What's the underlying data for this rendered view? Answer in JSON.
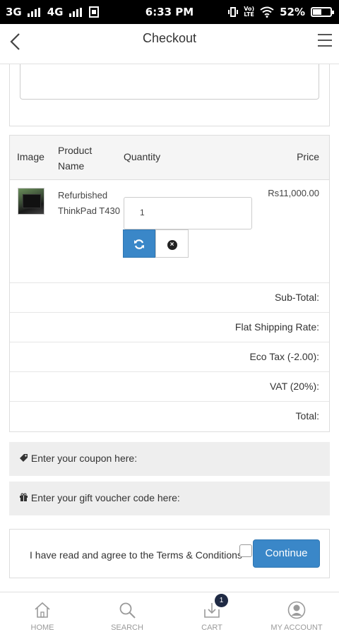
{
  "status_bar": {
    "network1": "3G",
    "network2": "4G",
    "time": "6:33 PM",
    "lte": "LTE",
    "volte": "Vo)",
    "battery_percent": "52%",
    "battery_level": 0.52
  },
  "header": {
    "title": "Checkout",
    "back_icon": "chevron-left-icon",
    "menu_icon": "hamburger-menu-icon"
  },
  "cart": {
    "columns": {
      "image": "Image",
      "product_name": "Product Name",
      "quantity": "Quantity",
      "price": "Price"
    },
    "items": [
      {
        "name": "Refurbished ThinkPad T430",
        "quantity": "1",
        "unit_price": "Rs11,000.00"
      }
    ],
    "totals": [
      {
        "label": "Sub-Total:"
      },
      {
        "label": "Flat Shipping Rate:"
      },
      {
        "label": "Eco Tax (-2.00):"
      },
      {
        "label": "VAT (20%):"
      },
      {
        "label": "Total:"
      }
    ]
  },
  "coupon": {
    "label": "Enter your coupon here:",
    "icon": "tag-icon"
  },
  "voucher": {
    "label": "Enter your gift voucher code here:",
    "icon": "gift-icon"
  },
  "terms": {
    "text": "I have read and agree to the Terms & Conditions",
    "continue_label": "Continue"
  },
  "bottom_nav": [
    {
      "label": "HOME",
      "icon": "home-icon"
    },
    {
      "label": "SEARCH",
      "icon": "search-icon"
    },
    {
      "label": "CART",
      "icon": "cart-download-icon",
      "badge": "1"
    },
    {
      "label": "MY ACCOUNT",
      "icon": "account-icon"
    }
  ],
  "colors": {
    "accent": "#3a87c8",
    "badge": "#1f2a44"
  }
}
